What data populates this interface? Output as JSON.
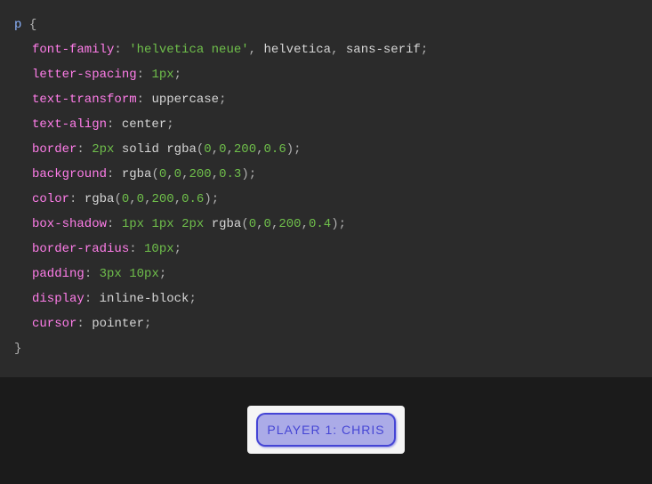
{
  "code": {
    "selector": "p",
    "open_brace": "{",
    "close_brace": "}",
    "lines": [
      {
        "prop": "font-family",
        "colon": ":",
        "segments": [
          {
            "text": "'helvetica neue'",
            "cls": "tok-str"
          },
          {
            "text": ",",
            "cls": "tok-punc"
          },
          {
            "text": " helvetica",
            "cls": "tok-val"
          },
          {
            "text": ",",
            "cls": "tok-punc"
          },
          {
            "text": " sans-serif",
            "cls": "tok-val"
          },
          {
            "text": ";",
            "cls": "tok-punc"
          }
        ]
      },
      {
        "prop": "letter-spacing",
        "colon": ":",
        "segments": [
          {
            "text": "1px",
            "cls": "tok-num"
          },
          {
            "text": ";",
            "cls": "tok-punc"
          }
        ]
      },
      {
        "prop": "text-transform",
        "colon": ":",
        "segments": [
          {
            "text": "uppercase",
            "cls": "tok-val"
          },
          {
            "text": ";",
            "cls": "tok-punc"
          }
        ]
      },
      {
        "prop": "text-align",
        "colon": ":",
        "segments": [
          {
            "text": "center",
            "cls": "tok-val"
          },
          {
            "text": ";",
            "cls": "tok-punc"
          }
        ]
      },
      {
        "prop": "border",
        "colon": ":",
        "segments": [
          {
            "text": "2px",
            "cls": "tok-num"
          },
          {
            "text": " solid ",
            "cls": "tok-val"
          },
          {
            "text": "rgba",
            "cls": "tok-func"
          },
          {
            "text": "(",
            "cls": "tok-punc"
          },
          {
            "text": "0",
            "cls": "tok-num"
          },
          {
            "text": ",",
            "cls": "tok-punc"
          },
          {
            "text": "0",
            "cls": "tok-num"
          },
          {
            "text": ",",
            "cls": "tok-punc"
          },
          {
            "text": "200",
            "cls": "tok-num"
          },
          {
            "text": ",",
            "cls": "tok-punc"
          },
          {
            "text": "0.6",
            "cls": "tok-num"
          },
          {
            "text": ")",
            "cls": "tok-punc"
          },
          {
            "text": ";",
            "cls": "tok-punc"
          }
        ]
      },
      {
        "prop": "background",
        "colon": ":",
        "segments": [
          {
            "text": "rgba",
            "cls": "tok-func"
          },
          {
            "text": "(",
            "cls": "tok-punc"
          },
          {
            "text": "0",
            "cls": "tok-num"
          },
          {
            "text": ",",
            "cls": "tok-punc"
          },
          {
            "text": "0",
            "cls": "tok-num"
          },
          {
            "text": ",",
            "cls": "tok-punc"
          },
          {
            "text": "200",
            "cls": "tok-num"
          },
          {
            "text": ",",
            "cls": "tok-punc"
          },
          {
            "text": "0.3",
            "cls": "tok-num"
          },
          {
            "text": ")",
            "cls": "tok-punc"
          },
          {
            "text": ";",
            "cls": "tok-punc"
          }
        ]
      },
      {
        "prop": "color",
        "colon": ":",
        "segments": [
          {
            "text": "rgba",
            "cls": "tok-func"
          },
          {
            "text": "(",
            "cls": "tok-punc"
          },
          {
            "text": "0",
            "cls": "tok-num"
          },
          {
            "text": ",",
            "cls": "tok-punc"
          },
          {
            "text": "0",
            "cls": "tok-num"
          },
          {
            "text": ",",
            "cls": "tok-punc"
          },
          {
            "text": "200",
            "cls": "tok-num"
          },
          {
            "text": ",",
            "cls": "tok-punc"
          },
          {
            "text": "0.6",
            "cls": "tok-num"
          },
          {
            "text": ")",
            "cls": "tok-punc"
          },
          {
            "text": ";",
            "cls": "tok-punc"
          }
        ]
      },
      {
        "prop": "box-shadow",
        "colon": ":",
        "segments": [
          {
            "text": "1px",
            "cls": "tok-num"
          },
          {
            "text": " ",
            "cls": "tok-val"
          },
          {
            "text": "1px",
            "cls": "tok-num"
          },
          {
            "text": " ",
            "cls": "tok-val"
          },
          {
            "text": "2px",
            "cls": "tok-num"
          },
          {
            "text": " ",
            "cls": "tok-val"
          },
          {
            "text": "rgba",
            "cls": "tok-func"
          },
          {
            "text": "(",
            "cls": "tok-punc"
          },
          {
            "text": "0",
            "cls": "tok-num"
          },
          {
            "text": ",",
            "cls": "tok-punc"
          },
          {
            "text": "0",
            "cls": "tok-num"
          },
          {
            "text": ",",
            "cls": "tok-punc"
          },
          {
            "text": "200",
            "cls": "tok-num"
          },
          {
            "text": ",",
            "cls": "tok-punc"
          },
          {
            "text": "0.4",
            "cls": "tok-num"
          },
          {
            "text": ")",
            "cls": "tok-punc"
          },
          {
            "text": ";",
            "cls": "tok-punc"
          }
        ]
      },
      {
        "prop": "border-radius",
        "colon": ":",
        "segments": [
          {
            "text": "10px",
            "cls": "tok-num"
          },
          {
            "text": ";",
            "cls": "tok-punc"
          }
        ]
      },
      {
        "prop": "padding",
        "colon": ":",
        "segments": [
          {
            "text": "3px",
            "cls": "tok-num"
          },
          {
            "text": " ",
            "cls": "tok-val"
          },
          {
            "text": "10px",
            "cls": "tok-num"
          },
          {
            "text": ";",
            "cls": "tok-punc"
          }
        ]
      },
      {
        "prop": "display",
        "colon": ":",
        "segments": [
          {
            "text": "inline-block",
            "cls": "tok-val"
          },
          {
            "text": ";",
            "cls": "tok-punc"
          }
        ]
      },
      {
        "prop": "cursor",
        "colon": ":",
        "segments": [
          {
            "text": "pointer",
            "cls": "tok-val"
          },
          {
            "text": ";",
            "cls": "tok-punc"
          }
        ]
      }
    ]
  },
  "preview": {
    "button_label": "Player 1: Chris"
  }
}
